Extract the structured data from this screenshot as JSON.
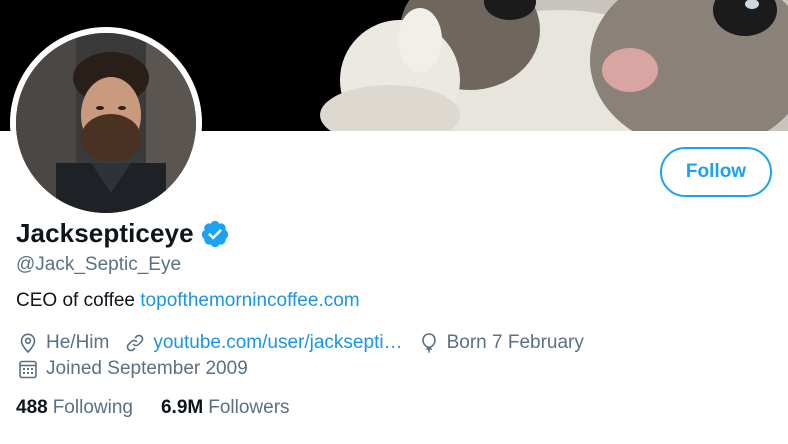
{
  "profile": {
    "display_name": "Jacksepticeye",
    "handle": "@Jack_Septic_Eye",
    "follow_label": "Follow",
    "bio_text": "CEO of coffee",
    "bio_link": "topofthemornincoffee.com",
    "pronouns": "He/Him",
    "website": "youtube.com/user/jacksepti…",
    "birthday": "Born 7 February",
    "joined": "Joined September 2009",
    "following_count": "488",
    "following_label": "Following",
    "followers_count": "6.9M",
    "followers_label": "Followers"
  },
  "icons": {
    "verified": "verified-badge-icon",
    "location": "location-pin-icon",
    "link": "link-icon",
    "birthday": "balloon-icon",
    "calendar": "calendar-icon"
  },
  "colors": {
    "accent": "#1da1f2",
    "link": "#1b95e0",
    "secondary_text": "#5b7083",
    "primary_text": "#0f1419"
  }
}
